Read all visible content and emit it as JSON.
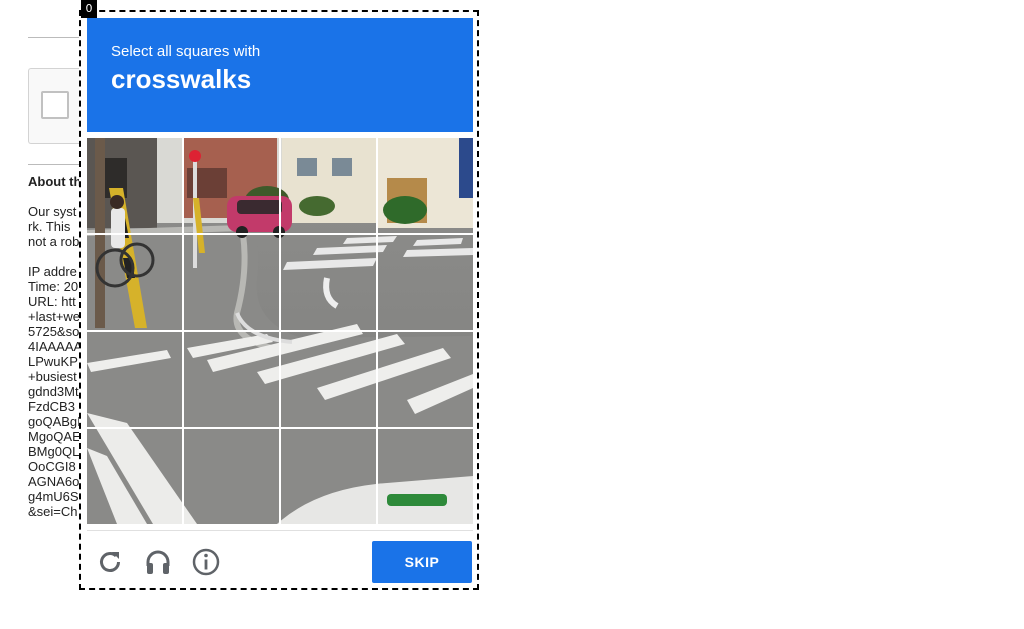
{
  "background_page": {
    "about_heading": "About th",
    "lines": [
      "Our syst",
      "rk. This",
      "not a rob",
      "",
      "IP addre",
      "Time: 20",
      "URL: htt",
      "+last+we",
      "5725&so",
      "4IAAAAA",
      "LPwuKPI",
      "+busiest",
      "gdnd3Mt",
      "FzdCB3",
      "goQABgI",
      "MgoQAE",
      "BMg0QL",
      "OoCGI8",
      "AGNA6o",
      "g4mU6S",
      "&sei=Ch"
    ]
  },
  "challenge": {
    "counter": "0",
    "instruction": "Select all squares with",
    "target": "crosswalks",
    "grid_size": "4x4",
    "skip_label": "SKIP",
    "icons": [
      "reload-icon",
      "audio-icon",
      "info-icon"
    ],
    "accent_color": "#1a73e8"
  }
}
